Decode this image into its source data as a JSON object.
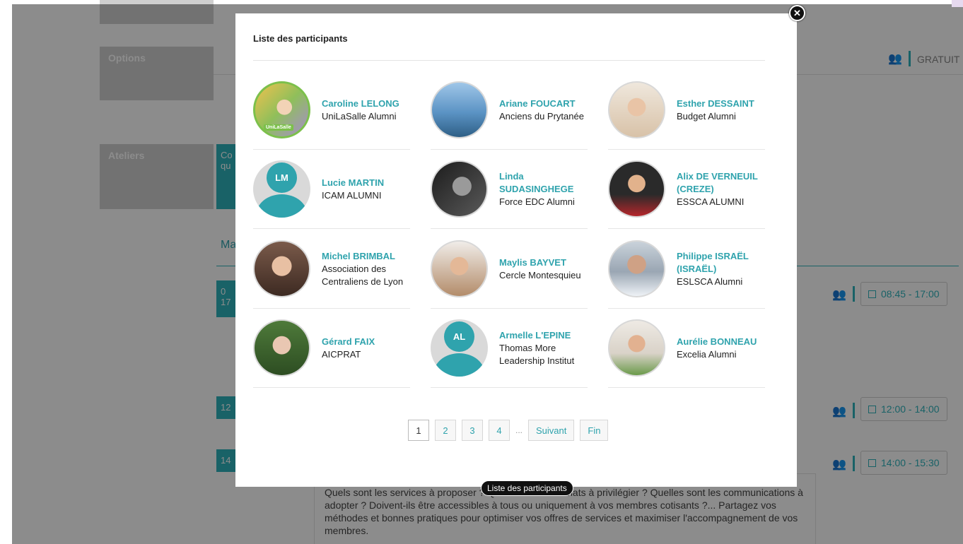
{
  "background": {
    "options_label": "Options",
    "ateliers_label": "Ateliers",
    "ateliers_teal_snip": "Co\nqu",
    "section_snip": "Ma",
    "slot1_snip": "0\n17",
    "slot2_snip": "12",
    "slot3_snip": "14",
    "gratuit_label": "GRATUIT",
    "times": [
      "08:45 - 17:00",
      "12:00 - 14:00",
      "14:00 - 15:30"
    ],
    "description": "Quels sont les services à proposer ? Quels sont les formats à privilégier ? Quelles sont les communications à adopter ? Doivent-ils être accessibles à tous ou uniquement à vos membres cotisants ?... Partagez vos méthodes et bonnes pratiques pour optimiser vos offres de services et maximiser l'accompagnement de vos membres."
  },
  "modal": {
    "title": "Liste des participants",
    "close_icon": "close-icon",
    "participants": [
      {
        "name": "Caroline LELONG",
        "org": "UniLaSalle Alumni",
        "avatar": "photo",
        "badge": "UniLaSalle"
      },
      {
        "name": "Ariane FOUCART",
        "org": "Anciens du Prytanée",
        "avatar": "photo"
      },
      {
        "name": "Esther DESSAINT",
        "org": "Budget Alumni",
        "avatar": "photo"
      },
      {
        "name": "Lucie MARTIN",
        "org": "ICAM ALUMNI",
        "avatar": "initials",
        "initials": "LM"
      },
      {
        "name": "Linda SUDASINGHEGE",
        "org": "Force EDC Alumni",
        "avatar": "photo"
      },
      {
        "name": "Alix DE VERNEUIL (CREZE)",
        "org": "ESSCA ALUMNI",
        "avatar": "photo"
      },
      {
        "name": "Michel BRIMBAL",
        "org": "Association des Centraliens de Lyon",
        "avatar": "photo"
      },
      {
        "name": "Maylis BAYVET",
        "org": "Cercle Montesquieu",
        "avatar": "photo"
      },
      {
        "name": "Philippe ISRAËL (ISRAËL)",
        "org": "ESLSCA Alumni",
        "avatar": "photo"
      },
      {
        "name": "Gérard FAIX",
        "org": "AICPRAT",
        "avatar": "photo"
      },
      {
        "name": "Armelle L'EPINE",
        "org": "Thomas More Leadership Institut",
        "avatar": "initials",
        "initials": "AL"
      },
      {
        "name": "Aurélie BONNEAU",
        "org": "Excelia Alumni",
        "avatar": "photo"
      }
    ],
    "pagination": {
      "pages": [
        "1",
        "2",
        "3",
        "4"
      ],
      "active": "1",
      "ellipsis": "...",
      "next_label": "Suivant",
      "last_label": "Fin"
    }
  },
  "tooltip": "Liste des participants",
  "colors": {
    "accent": "#2fa3ad",
    "overlay": "rgba(0,0,0,0.45)"
  }
}
